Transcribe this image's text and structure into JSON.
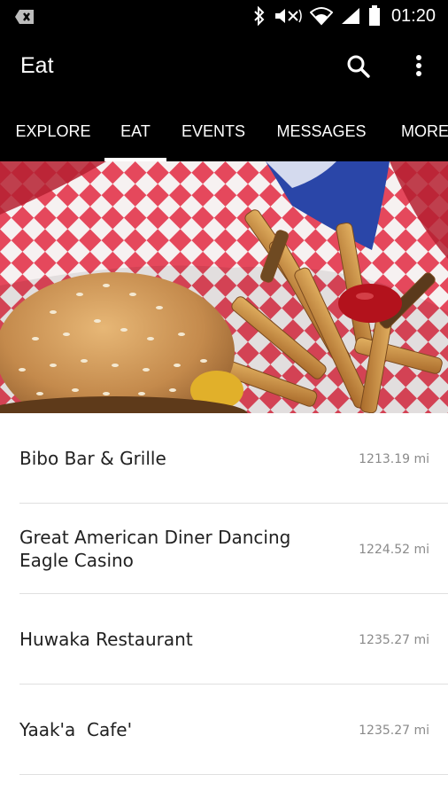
{
  "status_bar": {
    "time": "01:20",
    "icons": [
      "notification-icon",
      "bluetooth-icon",
      "mute-icon",
      "wifi-icon",
      "signal-icon",
      "battery-icon"
    ]
  },
  "toolbar": {
    "title": "Eat",
    "icons": [
      "search-icon",
      "overflow-menu-icon"
    ]
  },
  "tabs": [
    {
      "label": "EXPLORE",
      "selected": false
    },
    {
      "label": "EAT",
      "selected": true
    },
    {
      "label": "EVENTS",
      "selected": false
    },
    {
      "label": "MESSAGES",
      "selected": false
    },
    {
      "label": "MORE",
      "selected": false
    }
  ],
  "hero": {
    "image": "burger-and-fries-photo"
  },
  "restaurants": [
    {
      "name": "Bibo Bar & Grille",
      "distance": "1213.19 mi"
    },
    {
      "name": "Great American Diner Dancing Eagle Casino",
      "distance": "1224.52 mi"
    },
    {
      "name": "Huwaka Restaurant",
      "distance": "1235.27 mi"
    },
    {
      "name": "Yaak'a  Cafe'",
      "distance": "1235.27 mi"
    }
  ],
  "colors": {
    "app_bar": "#000000",
    "tab_text": "#ffffff",
    "list_text": "#212121",
    "distance_text": "#8a8a8a",
    "divider": "#e0e0e0"
  }
}
